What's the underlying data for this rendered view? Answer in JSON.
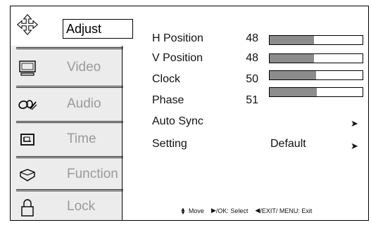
{
  "sidebar": {
    "items": [
      {
        "key": "adjust",
        "label": "Adjust",
        "icon": "move-arrows-icon",
        "active": true
      },
      {
        "key": "video",
        "label": "Video",
        "icon": "monitor-icon",
        "active": false
      },
      {
        "key": "audio",
        "label": "Audio",
        "icon": "audio-icon",
        "active": false
      },
      {
        "key": "time",
        "label": "Time",
        "icon": "clock-window-icon",
        "active": false
      },
      {
        "key": "function",
        "label": "Function",
        "icon": "function-icon",
        "active": false
      },
      {
        "key": "lock",
        "label": "Lock",
        "icon": "lock-icon",
        "active": false
      }
    ]
  },
  "settings": [
    {
      "label": "H Position",
      "value": "48",
      "level": 0.48
    },
    {
      "label": "V Position",
      "value": "48",
      "level": 0.48
    },
    {
      "label": "Clock",
      "value": "50",
      "level": 0.5
    },
    {
      "label": "Phase",
      "value": "51",
      "level": 0.51
    }
  ],
  "auto_sync": {
    "label": "Auto Sync",
    "arrow": "➤"
  },
  "setting": {
    "label": "Setting",
    "value": "Default",
    "arrow": "➤"
  },
  "hint": {
    "move": "Move",
    "ok": "/OK: Select",
    "exit": "/EXIT/ MENU: Exit",
    "move_glyph": "▴▾",
    "ok_glyph": "▶",
    "exit_glyph": "◀"
  },
  "colors": {
    "bar_fill": "#8c8c8c",
    "sidebar_bg": "#ececec",
    "inactive_text": "#9a9a9a"
  }
}
